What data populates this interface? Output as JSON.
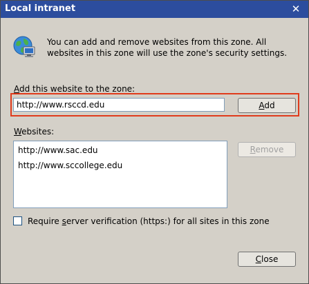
{
  "window": {
    "title": "Local intranet",
    "close_glyph": "✕"
  },
  "intro": {
    "icon": "globe-computer-icon",
    "text": "You can add and remove websites from this zone. All websites in this zone will use the zone's security settings."
  },
  "add_section": {
    "label_mnemonic": "A",
    "label_rest": "dd this website to the zone:",
    "input_value": "http://www.rsccd.edu",
    "add_button_mnemonic": "A",
    "add_button_rest": "dd"
  },
  "websites_section": {
    "label_mnemonic": "W",
    "label_rest": "ebsites:",
    "items": [
      "http://www.sac.edu",
      "http://www.sccollege.edu"
    ],
    "remove_button_mnemonic": "R",
    "remove_button_rest": "emove"
  },
  "verification": {
    "checked": false,
    "label_pre": "Require ",
    "label_mnemonic": "s",
    "label_post": "erver verification (https:) for all sites in this zone"
  },
  "footer": {
    "close_button_mnemonic": "C",
    "close_button_rest": "lose"
  },
  "colors": {
    "titlebar": "#2c4d9e",
    "highlight": "#e03a1b",
    "dialog_bg": "#d4d0c8"
  }
}
